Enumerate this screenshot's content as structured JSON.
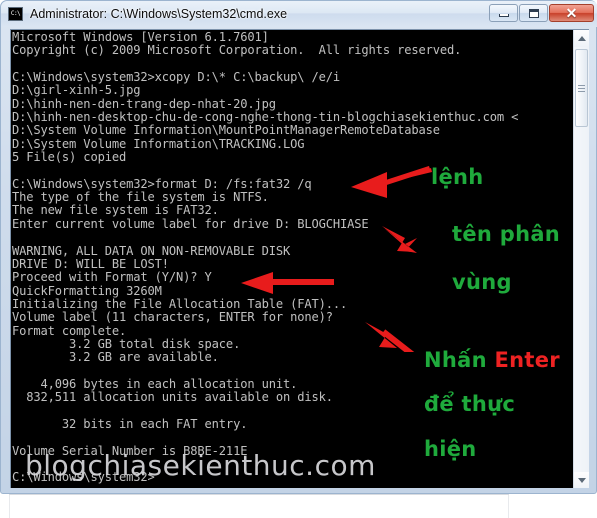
{
  "window": {
    "title": "Administrator: C:\\Windows\\System32\\cmd.exe",
    "icon_label": "C:\\",
    "buttons": {
      "minimize": "Minimize",
      "maximize": "Maximize",
      "close": "Close"
    }
  },
  "console": {
    "lines": [
      "Microsoft Windows [Version 6.1.7601]",
      "Copyright (c) 2009 Microsoft Corporation.  All rights reserved.",
      "",
      "C:\\Windows\\system32>xcopy D:\\* C:\\backup\\ /e/i",
      "D:\\girl-xinh-5.jpg",
      "D:\\hinh-nen-den-trang-dep-nhat-20.jpg",
      "D:\\hinh-nen-desktop-chu-de-cong-nghe-thong-tin-blogchiasekienthuc.com <",
      "D:\\System Volume Information\\MountPointManagerRemoteDatabase",
      "D:\\System Volume Information\\TRACKING.LOG",
      "5 File(s) copied",
      "",
      "C:\\Windows\\system32>format D: /fs:fat32 /q",
      "The type of the file system is NTFS.",
      "The new file system is FAT32.",
      "Enter current volume label for drive D: BLOGCHIASE",
      "",
      "WARNING, ALL DATA ON NON-REMOVABLE DISK",
      "DRIVE D: WILL BE LOST!",
      "Proceed with Format (Y/N)? Y",
      "QuickFormatting 3260M",
      "Initializing the File Allocation Table (FAT)...",
      "Volume label (11 characters, ENTER for none)?",
      "Format complete.",
      "        3.2 GB total disk space.",
      "        3.2 GB are available.",
      "",
      "    4,096 bytes in each allocation unit.",
      "  832,511 allocation units available on disk.",
      "",
      "       32 bits in each FAT entry.",
      "",
      "Volume Serial Number is B8BE-211E",
      "",
      "C:\\Windows\\system32>"
    ]
  },
  "annotations": [
    {
      "id": "anno-lenh",
      "text": "lệnh"
    },
    {
      "id": "anno-ten-phan",
      "text": "tên phân"
    },
    {
      "id": "anno-vung",
      "text": "vùng"
    },
    {
      "id": "anno-nhan",
      "text": "Nhấn "
    },
    {
      "id": "anno-enter",
      "text": "Enter"
    },
    {
      "id": "anno-de-thuc",
      "text": "để thực"
    },
    {
      "id": "anno-hien",
      "text": "hiện"
    }
  ],
  "watermark": {
    "text": "blogchiasekienthuc.com"
  },
  "colors": {
    "annotation_green": "#1faa3c",
    "annotation_red": "#ee2222",
    "arrow_red": "#e81c1c",
    "console_bg": "#000000",
    "console_fg": "#c0c0c0"
  },
  "icons": {
    "scroll_up": "triangle-up-icon",
    "scroll_down": "triangle-down-icon",
    "minimize": "minimize-icon",
    "maximize": "maximize-icon",
    "close": "close-icon"
  }
}
